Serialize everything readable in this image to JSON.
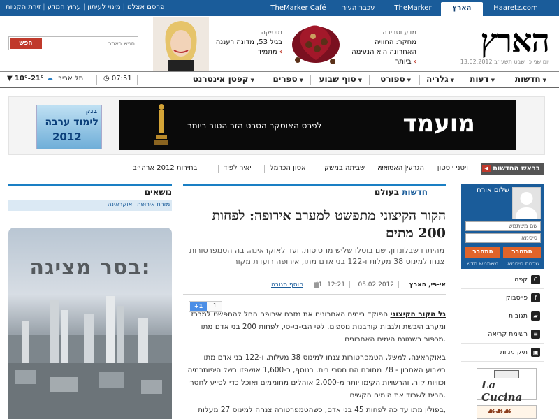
{
  "topbar": {
    "site_tabs": [
      "Haaretz.com",
      "הארץ",
      "TheMarker",
      "עכבר העיר",
      "TheMarker Café"
    ],
    "links": [
      "פרסם אצלנו",
      "מינוי לעיתון",
      "ערוץ המדע",
      "זירת הקניות"
    ]
  },
  "header": {
    "logo": "הארץ",
    "date": "יום שני כ׳ שבט תשע״ב 13.02.2012",
    "promo1": {
      "category": "מדע וסביבה",
      "line1": "מחקר: החוויה",
      "line2": "האחרונה היא הנעימה",
      "more": "ביותר"
    },
    "promo2": {
      "category": "מוסיקה",
      "line1": "בגיל 53, מדונה רעננה",
      "more": "מתמיד"
    },
    "search_placeholder": "חפש באתר",
    "search_button": "חפש"
  },
  "nav": {
    "items": [
      "חדשות",
      "דעות",
      "גלריה",
      "ספורט",
      "סוף שבוע",
      "ספרים",
      "קפטן אינטרנט"
    ],
    "clock": "07:51",
    "city": "תל אביב",
    "temp": "10°-21°"
  },
  "ads": {
    "oscar_title": "מועמד",
    "oscar_sub": "לפרס האוסקר  הסרט הזר הטוב ביותר",
    "small_line1": "בנק",
    "small_line2": "לימוד ערבה",
    "small_year": "2012"
  },
  "breaking": {
    "label": "בראש החדשות",
    "items": [
      "ויטני יוסטון",
      "הגרעין האיראני",
      "סוריה",
      "שביתה במשק",
      "אסון הכרמל",
      "יאיר לפיד",
      "בחירות 2012 ארה״ב"
    ]
  },
  "topics": {
    "title": "נושאים",
    "tags": [
      "מזרח אירופה",
      "אוקראינה"
    ],
    "exhibit_title": "בסר מציגה:"
  },
  "article": {
    "section_main": "חדשות",
    "section_sub": "בעולם",
    "headline": "הקור הקיצוני מתפשט למערב אירופה: לפחות 200 מתים",
    "subhead": "מהיתרו שבלונדון, שם בוטלו שליש מהטיסות, ועד לאוקראינה, בה הטמפרטורות צנחו למינוס 38 מעלות ו-122 בני אדם מתו, אירופה רועדת מקור",
    "byline_source": "אי-פי, הארץ",
    "date": "05.02.2012",
    "time": "12:21",
    "comments_count": "41",
    "add_comment": "הוסף תגובה",
    "gplus_label": "+1",
    "gplus_count": "1",
    "para1_lead": "גל הקור הקיצוני",
    "para1_rest": " הפוקד בימים האחרונים את מזרח אירופה החל להתפשט למרכז ומערב היבשת ולגבות קורבנות נוספים. לפי הבי-בי-סי, לפחות 200 בני אדם מתו מכפור בשמונת הימים האחרונים.",
    "para2": "באוקראינה, למשל, הטמפרטורות צנחו למינוס 38 מעלות, ו-122 בני אדם מתו בשבוע האחרון - 78 מתוכם הם חסרי בית. בנוסף, כ-1,600 אושפזו בשל היפותרמיה וכוויות קור, והרשויות הקימו יותר מ-2,000 אוהלים מחוממים ואוכל כדי לסייע לחסרי הבית לשרוד את הימים הקשים.",
    "para3": "בפולין מתו עד כה לפחות 45 בני אדם, כשהטמפרטורה צנחה למינוס 27 מעלות,"
  },
  "userbox": {
    "hello": "שלום אורח",
    "username_placeholder": "שם משתמש",
    "password_placeholder": "סיסמא",
    "register": "התחבר",
    "login": "התחבר",
    "forgot_password": "שכחת סיסמא",
    "forgot_user": "משתמש חדש"
  },
  "sidebar_menu": [
    "קפה",
    "פייסבוק",
    "תגובות",
    "רשימת קריאה",
    "תיק מניות"
  ],
  "sidebar_ads": {
    "lacucina": "La Cucina"
  }
}
